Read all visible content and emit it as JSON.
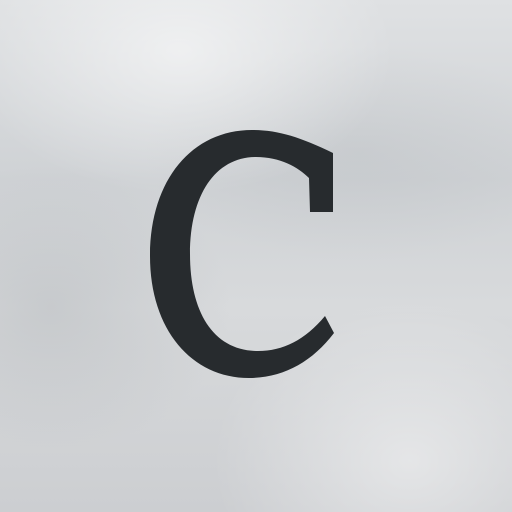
{
  "app_icon": {
    "letter": "C",
    "letter_color": "#272b2e",
    "background_color": "#d4d6d8",
    "icon_name": "letter-c-app-icon"
  }
}
